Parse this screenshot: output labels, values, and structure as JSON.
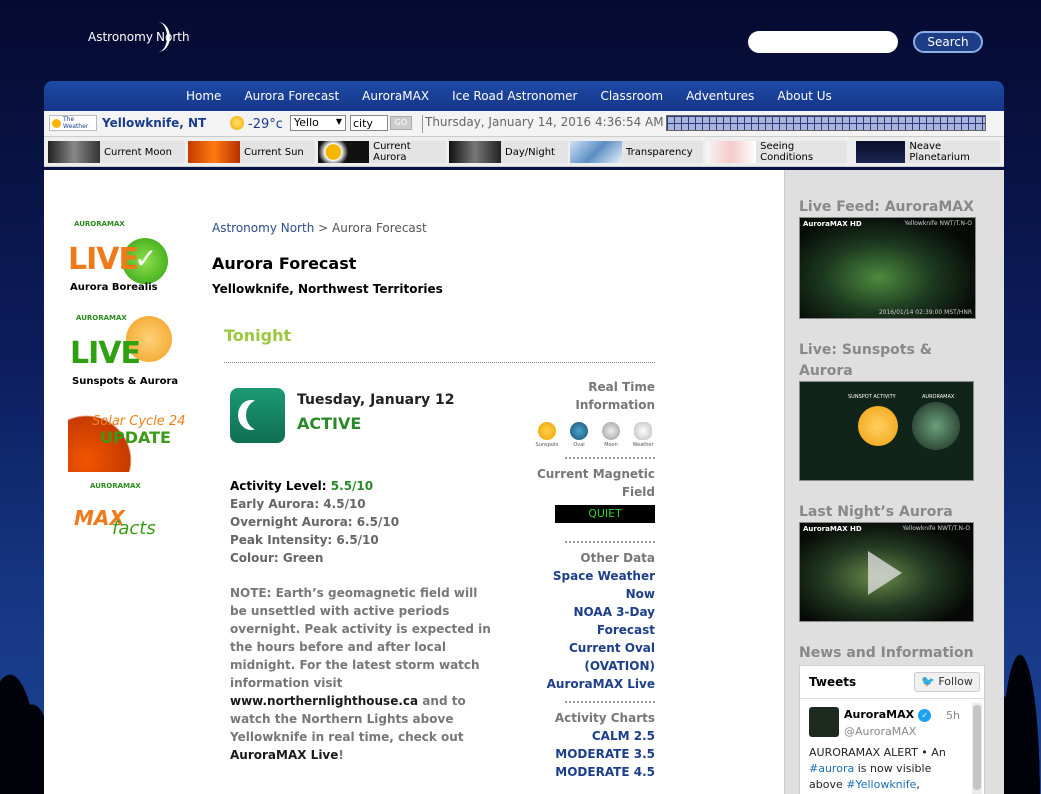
{
  "header": {
    "logo_part1": "Astronomy",
    "logo_part2": "North",
    "search_placeholder": "",
    "search_button": "Search"
  },
  "nav": {
    "items": [
      "Home",
      "Aurora Forecast",
      "AuroraMAX",
      "Ice Road Astronomer",
      "Classroom",
      "Adventures",
      "About Us"
    ]
  },
  "weather": {
    "network_logo": "The Weather Network",
    "city": "Yellowknife, NT",
    "temperature": "-29°c",
    "select_value": "Yello",
    "city_input_value": "city",
    "go_label": "GO",
    "datetime": "Thursday, January 14, 2016 4:36:54 AM"
  },
  "data_links": [
    "Current Moon",
    "Current Sun",
    "Current Aurora",
    "Day/Night",
    "Transparency",
    "Seeing Conditions",
    "Neave Planetarium"
  ],
  "left_badges": {
    "live1_top": "AURORAMAX",
    "live1_main": "LIVE",
    "live1_sub": "Aurora Borealis",
    "live2_top": "AURORAMAX",
    "live2_main": "LIVE",
    "live2_sub": "Sunspots & Aurora",
    "solar_line1": "Solar Cycle 24",
    "solar_line2": "UPDATE",
    "max_top": "AURORAMAX",
    "max_main": "MAX",
    "max_sub": "facts"
  },
  "main": {
    "breadcrumb_home": "Astronomy North",
    "breadcrumb_sep": ">",
    "breadcrumb_current": "Aurora Forecast",
    "title": "Aurora Forecast",
    "location": "Yellowknife, Northwest Territories",
    "section": "Tonight",
    "forecast_date": "Tuesday, January 12",
    "forecast_status": "ACTIVE",
    "activity_label": "Activity Level:",
    "activity_value": "5.5/10",
    "early": "Early Aurora: 4.5/10",
    "overnight": "Overnight Aurora: 6.5/10",
    "peak": "Peak Intensity: 6.5/10",
    "colour": "Colour: Green",
    "note_text": "NOTE: Earth’s geomagnetic field will be unsettled with active periods overnight. Peak activity is expected in the hours before and after local midnight. For the latest storm watch information visit",
    "note_link1": "www.northernlighthouse.ca",
    "note_mid": "and to watch the Northern Lights above Yellowknife in real time, check out",
    "note_link2": "AuroraMAX Live",
    "note_end": "!"
  },
  "side_info": {
    "rt_title": "Real Time Information",
    "rt_icons": [
      "Sunspots",
      "Oval",
      "Moon",
      "Weather"
    ],
    "mag_title": "Current Magnetic Field",
    "mag_status": "QUIET",
    "other_title": "Other Data",
    "other_links": [
      "Space Weather Now",
      "NOAA 3-Day Forecast",
      "Current Oval (OVATION)",
      "AuroraMAX Live"
    ],
    "charts_title": "Activity Charts",
    "charts": [
      "CALM 2.5",
      "MODERATE 3.5",
      "MODERATE 4.5"
    ]
  },
  "right": {
    "feed_title": "Live Feed: AuroraMAX",
    "feed_img_label": "AuroraMAX HD",
    "feed_img_location": "Yellowknife NWT/T.N-O",
    "feed_img_time": "2016/01/14 02:39:00 MST/HNR",
    "sunspots_title": "Live: Sunspots & Aurora",
    "sunspot_left_label": "SUNSPOT ACTIVITY",
    "sunspot_right_label": "AURORAMAX",
    "lastnight_title": "Last Night’s Aurora",
    "lastnight_label": "AuroraMAX HD",
    "lastnight_location": "Yellowknife NWT/T.N-O",
    "news_title": "News and Information"
  },
  "twitter": {
    "tweets_label": "Tweets",
    "follow_label": "Follow",
    "name": "AuroraMAX",
    "handle": "@AuroraMAX",
    "time": "5h",
    "text_start": "AURORAMAX ALERT • An",
    "tag1": "#aurora",
    "text_mid": "is now visible above",
    "tag2": "#Yellowknife",
    "text_end": ","
  }
}
